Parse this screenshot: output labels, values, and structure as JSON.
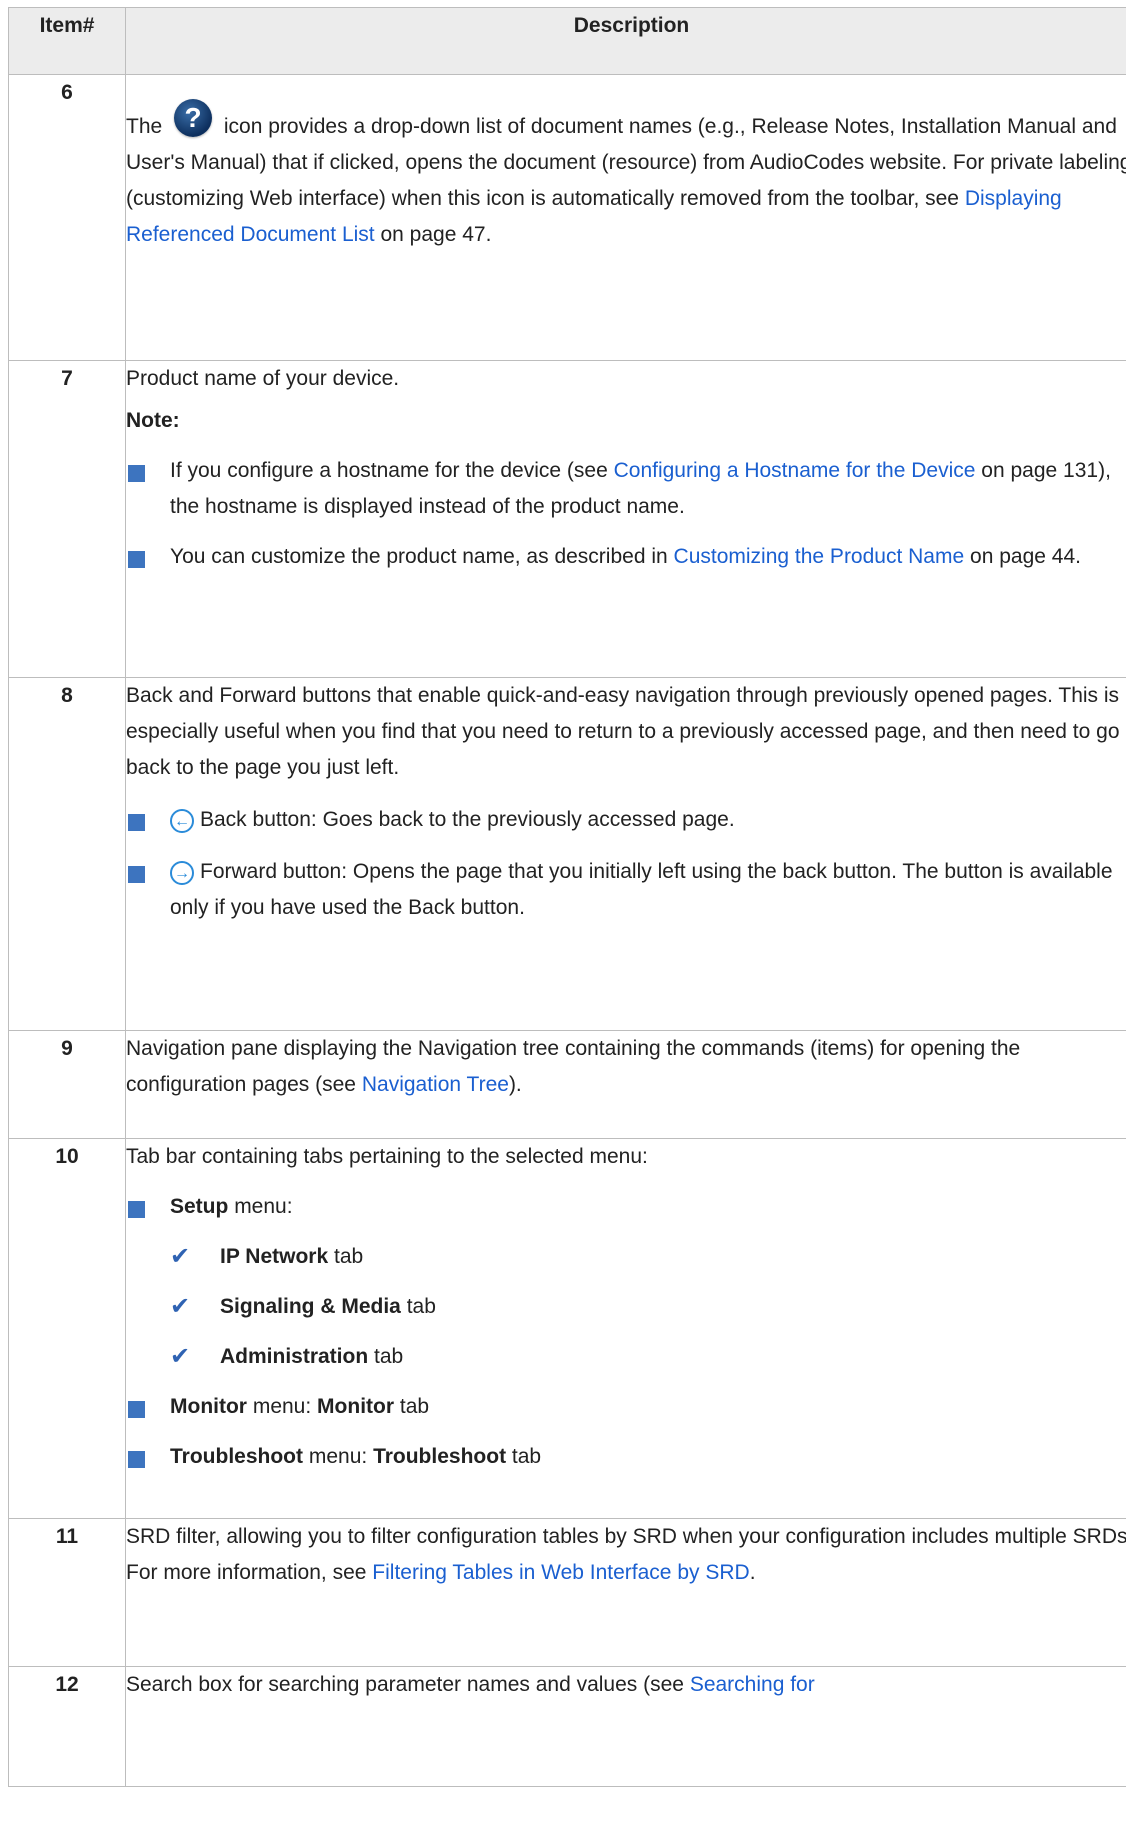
{
  "header": {
    "item": "Item#",
    "description": "Description"
  },
  "rows": {
    "r6": {
      "num": "6",
      "pre": "The",
      "post": "icon provides a drop-down list of document names (e.g., Release Notes, Installation Manual and User's Manual) that if clicked, opens the document (resource) from AudioCodes website. For private labeling (customizing Web interface) when this icon is automatically removed from the toolbar, see",
      "link": "Displaying Referenced Document List",
      "tail": "on page 47."
    },
    "r7": {
      "num": "7",
      "text": "Product name of your device.",
      "note": "Note:",
      "b1_pre": "If you configure a hostname for the device (see",
      "b1_link": "Configuring a Hostname for the Device",
      "b1_post": "on page 131), the hostname is displayed instead of the product name.",
      "b2_pre": "You can customize the product name, as described in",
      "b2_link": "Customizing the Product Name",
      "b2_post": "on page 44."
    },
    "r8": {
      "num": "8",
      "text": "Back and Forward buttons that enable quick-and-easy navigation through previously opened pages. This is especially useful when you find that you need to return to a previously accessed page, and then need to go back to the page you just left.",
      "b1": "Back button: Goes back to the previously accessed page.",
      "b2": "Forward button: Opens the page that you initially left using the back button. The button is available only if you have used the Back button."
    },
    "r9": {
      "num": "9",
      "pre": "Navigation pane displaying the Navigation tree containing the commands (items) for opening the configuration pages (see",
      "link": "Navigation Tree",
      "post": ")."
    },
    "r10": {
      "num": "10",
      "text": "Tab bar containing tabs pertaining to the selected menu:",
      "setup_b": "Setup",
      "setup_t": "menu:",
      "c1_b": "IP Network",
      "c1_t": "tab",
      "c2_b": "Signaling & Media",
      "c2_t": "tab",
      "c3_b": "Administration",
      "c3_t": "tab",
      "mon_b1": "Monitor",
      "mon_t1": "menu:",
      "mon_b2": "Monitor",
      "mon_t2": "tab",
      "tr_b1": "Troubleshoot",
      "tr_t1": "menu:",
      "tr_b2": "Troubleshoot",
      "tr_t2": "tab"
    },
    "r11": {
      "num": "11",
      "pre": "SRD filter, allowing you to filter configuration tables by SRD when your configuration includes multiple SRDs. For more information, see",
      "link": "Filtering Tables in Web Interface by SRD",
      "post": "."
    },
    "r12": {
      "num": "12",
      "pre": "Search box for searching parameter names and values (see",
      "link": "Searching for"
    }
  },
  "icons": {
    "help": "question-mark-icon",
    "back": "back-arrow-icon",
    "forward": "forward-arrow-icon",
    "bullet": "square-bullet",
    "check": "check-mark-icon"
  },
  "colors": {
    "link": "#1a5fd0",
    "bullet": "#3d74bf",
    "header_bg": "#ececec",
    "border": "#bdbdbd"
  }
}
